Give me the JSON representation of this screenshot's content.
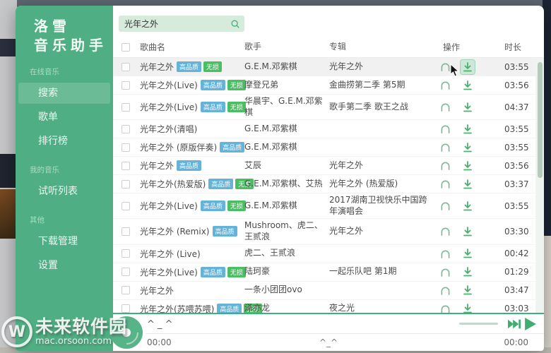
{
  "app_name": "洛雪音乐助手",
  "colors": {
    "accent_green": "#4fae83",
    "badge_hq_blue": "#66b3d9",
    "badge_lossless_green": "#4bbd63",
    "window_dot_green": "#7cc043",
    "window_dot_red": "#e25944",
    "player_border_green": "#3cb07e"
  },
  "sidebar": {
    "logo_line1": "洛雪",
    "logo_line2": "音乐助手",
    "sections": [
      {
        "label": "在线音乐",
        "items": [
          {
            "label": "搜索",
            "active": true
          },
          {
            "label": "歌单"
          },
          {
            "label": "排行榜"
          }
        ]
      },
      {
        "label": "我的音乐",
        "items": [
          {
            "label": "试听列表"
          }
        ]
      },
      {
        "label": "其他",
        "items": [
          {
            "label": "下载管理"
          },
          {
            "label": "设置"
          }
        ]
      }
    ]
  },
  "search": {
    "value": "光年之外"
  },
  "table": {
    "headers": {
      "song": "歌曲名",
      "artist": "歌手",
      "album": "专辑",
      "ops": "操作",
      "duration": "时长"
    },
    "badges": {
      "hq": "高品质",
      "lossless": "无损"
    },
    "rows": [
      {
        "song": "光年之外",
        "tags": [
          "hq",
          "lossless"
        ],
        "artist": "G.E.M.邓紫棋",
        "album": "光年之外",
        "duration": "03:55",
        "selected": true,
        "download_hover": true
      },
      {
        "song": "光年之外(Live)",
        "tags": [
          "hq",
          "lossless"
        ],
        "artist": "摩登兄弟",
        "album": "金曲捞第二季 第5期",
        "duration": "03:56"
      },
      {
        "song": "光年之外(Live)",
        "tags": [
          "hq",
          "lossless"
        ],
        "artist": "华晨宇、G.E.M.邓紫棋",
        "album": "歌手第二季 歌王之战",
        "duration": "04:37"
      },
      {
        "song": "光年之外(清唱)",
        "tags": [],
        "artist": "G.E.M.邓紫棋",
        "album": "",
        "duration": "03:55"
      },
      {
        "song": "光年之外 (原版伴奏)",
        "tags": [
          "hq"
        ],
        "artist": "G.E.M.邓紫棋",
        "album": "",
        "duration": "03:55"
      },
      {
        "song": "光年之外",
        "tags": [
          "hq"
        ],
        "artist": "艾辰",
        "album": "光年之外",
        "duration": "03:56"
      },
      {
        "song": "光年之外(热爱版)",
        "tags": [
          "hq",
          "lossless"
        ],
        "artist": "G.E.M.邓紫棋、艾热",
        "album": "光年之外 (热爱版)",
        "duration": "03:37"
      },
      {
        "song": "光年之外(Live)",
        "tags": [
          "hq",
          "lossless"
        ],
        "artist": "G.E.M.邓紫棋",
        "album": "2017湖南卫视快乐中国跨年演唱会",
        "duration": "03:55"
      },
      {
        "song": "光年之外 (Remix)",
        "tags": [
          "hq"
        ],
        "artist": "Mushroom、虎二、王贰浪",
        "album": "光年之外",
        "duration": "03:30"
      },
      {
        "song": "光年之外 (Live)",
        "tags": [],
        "artist": "虎二、王贰浪",
        "album": "",
        "duration": "00:42"
      },
      {
        "song": "光年之外(Live)",
        "tags": [
          "hq",
          "lossless"
        ],
        "artist": "陆珂豪",
        "album": "一起乐队吧 第1期",
        "duration": "01:29"
      },
      {
        "song": "光年之外",
        "tags": [],
        "artist": "一条小团团ovo",
        "album": "",
        "duration": "03:47"
      },
      {
        "song": "光年之外(苏喂苏喂)",
        "tags": [
          "hq",
          "lossless"
        ],
        "artist": "泽亦龙",
        "album": "夜之光",
        "duration": "03:03"
      }
    ]
  },
  "player": {
    "title": "^ _ ^",
    "current_time": "00:00",
    "total_time": "00:00",
    "lyric": "^_^"
  },
  "watermark": {
    "logo_letter": "W",
    "title": "未来软件园",
    "url": "mac.orsoon.com"
  }
}
